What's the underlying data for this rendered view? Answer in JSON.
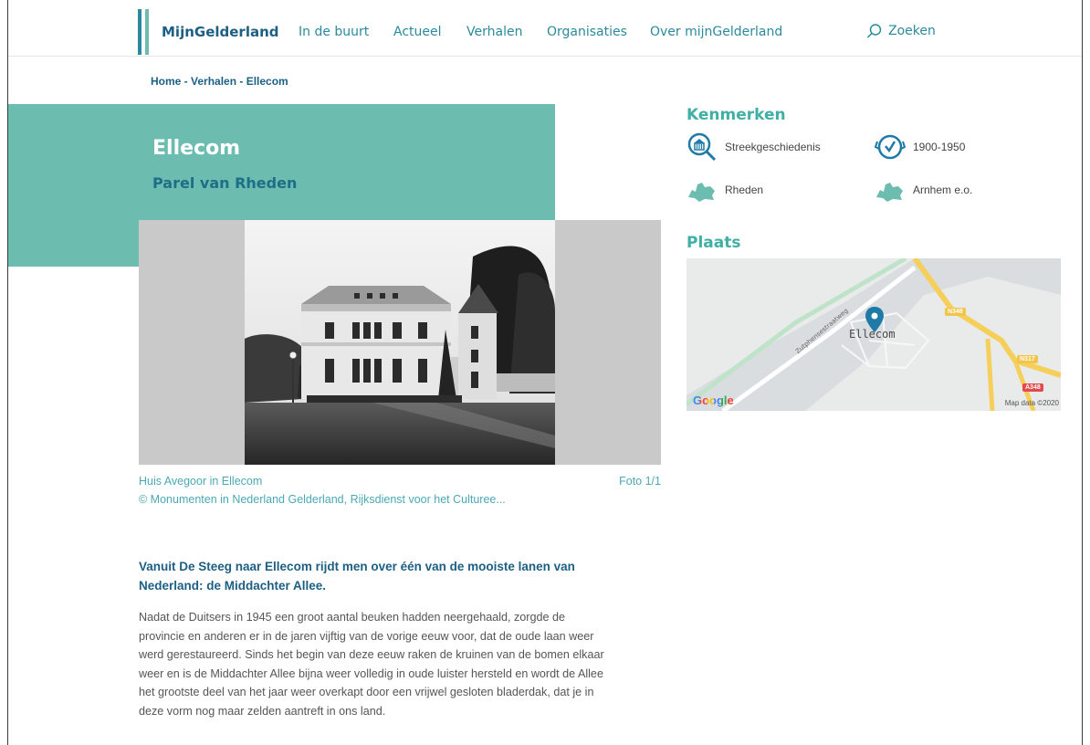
{
  "brand": {
    "prefix": "Mijn",
    "name": "Gelderland"
  },
  "nav": {
    "items": [
      {
        "label": "In de buurt"
      },
      {
        "label": "Actueel"
      },
      {
        "label": "Verhalen"
      },
      {
        "label": "Organisaties"
      },
      {
        "label": "Over mijnGelderland"
      }
    ],
    "search_label": "Zoeken"
  },
  "breadcrumb": "Home - Verhalen - Ellecom",
  "hero": {
    "title": "Ellecom",
    "subtitle": "Parel van Rheden"
  },
  "photo": {
    "caption": "Huis Avegoor in Ellecom",
    "credit": "© Monumenten in Nederland Gelderland, Rijksdienst voor het Culturee...",
    "position": "Foto 1/1"
  },
  "article": {
    "lead": "Vanuit De Steeg naar Ellecom rijdt men over één van de mooiste lanen van Nederland: de Middachter Allee.",
    "body": "Nadat de Duitsers in 1945 een groot aantal beuken hadden neergehaald, zorgde de provincie en anderen er in de jaren vijftig van de vorige eeuw voor, dat de oude laan weer werd gerestaureerd. Sinds het begin van deze eeuw raken de kruinen van de bomen elkaar weer en is de Middachter Allee bijna weer volledig in oude luister hersteld en wordt de Allee het grootste deel van het jaar weer overkapt door een vrijwel gesloten bladerdak, dat je in deze vorm nog maar zelden aantreft in ons land."
  },
  "features": {
    "title": "Kenmerken",
    "items": [
      {
        "label": "Streekgeschiedenis",
        "icon": "magnifier-building-icon"
      },
      {
        "label": "1900-1950",
        "icon": "clock-icon"
      },
      {
        "label": "Rheden",
        "icon": "region-map-icon"
      },
      {
        "label": "Arnhem e.o.",
        "icon": "region-map-icon"
      }
    ]
  },
  "place": {
    "title": "Plaats",
    "map": {
      "place_label": "Ellecom",
      "street_label": "Zutphensestraatweg",
      "road_labels": [
        "N348",
        "N317",
        "A348"
      ],
      "provider": "Google",
      "attribution": "Map data ©2020"
    }
  },
  "colors": {
    "brand_blue": "#1d5f84",
    "teal": "#6cbcb0",
    "nav_teal": "#2a8a9c",
    "caption_teal": "#4aa9b4",
    "pin_blue": "#1f7aa8"
  }
}
